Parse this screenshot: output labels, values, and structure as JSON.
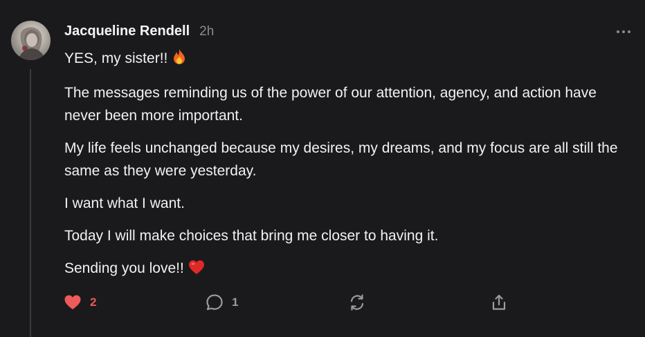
{
  "comment": {
    "author": "Jacqueline Rendell",
    "timestamp": "2h",
    "paragraphs": [
      "YES, my sister!!",
      "The messages reminding us of the power of our attention, agency, and action have never been more important.",
      "My life feels unchanged because my desires, my dreams, and my focus are all still the same as they were yesterday.",
      "I want what I want.",
      "Today I will make choices that bring me closer to having it.",
      "Sending you love!!"
    ],
    "emojis": {
      "first_paragraph": "fire-emoji",
      "last_paragraph": "red-heart-emoji"
    }
  },
  "actions": {
    "like_count": "2",
    "reply_count": "1",
    "icons": [
      "heart-icon",
      "comment-icon",
      "restack-icon",
      "share-icon"
    ]
  },
  "colors": {
    "background": "#1a1a1c",
    "text": "#f2f2f2",
    "muted": "#8c8c8f",
    "like": "#ef5a5a"
  }
}
